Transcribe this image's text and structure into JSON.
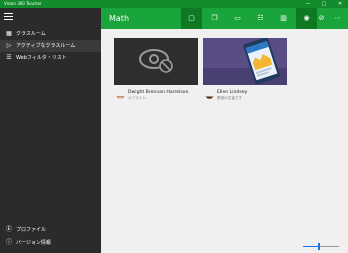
{
  "window": {
    "title": "Vision 360 Teacher",
    "minimize_glyph": "—",
    "maximize_glyph": "□",
    "close_glyph": "✕"
  },
  "sidebar": {
    "items": [
      {
        "label": "クラスルーム",
        "icon": "classroom-icon",
        "glyph": "▦"
      },
      {
        "label": "アクティブなクラスルーム",
        "icon": "play-icon",
        "glyph": "▷"
      },
      {
        "label": "Webフィルタ・リスト",
        "icon": "list-icon",
        "glyph": "☰"
      }
    ],
    "bottom_items": [
      {
        "label": "プロファイル",
        "icon": "profile-icon",
        "glyph": "Ⓔ"
      },
      {
        "label": "バージョン情報",
        "icon": "info-icon",
        "glyph": "ⓘ"
      }
    ]
  },
  "header": {
    "title": "Math",
    "toolbar": [
      {
        "icon": "screen-icon",
        "glyph": "▢",
        "selected": true
      },
      {
        "icon": "screens-icon",
        "glyph": "❐",
        "selected": false
      },
      {
        "icon": "message-icon",
        "glyph": "▭",
        "selected": false
      },
      {
        "icon": "chat-icon",
        "glyph": "☷",
        "selected": false
      },
      {
        "icon": "book-icon",
        "glyph": "▥",
        "selected": false
      },
      {
        "icon": "web-icon",
        "glyph": "◉",
        "selected": true
      },
      {
        "icon": "block-icon",
        "glyph": "⊘",
        "selected": false
      },
      {
        "icon": "more-icon",
        "glyph": "⋯",
        "selected": false
      }
    ]
  },
  "students": [
    {
      "name": "Dwight Brennan Harrelson",
      "status": "オフライン",
      "thumbnail": "offline"
    },
    {
      "name": "Ellen Lindsey",
      "status": "教室の生徒です",
      "thumbnail": "screen"
    }
  ],
  "zoom": {
    "level": 0.45
  },
  "colors": {
    "accent": "#1aa43c",
    "titlebar": "#118b2b",
    "selected": "#0d7a23",
    "sidebar": "#2b2b2b"
  }
}
